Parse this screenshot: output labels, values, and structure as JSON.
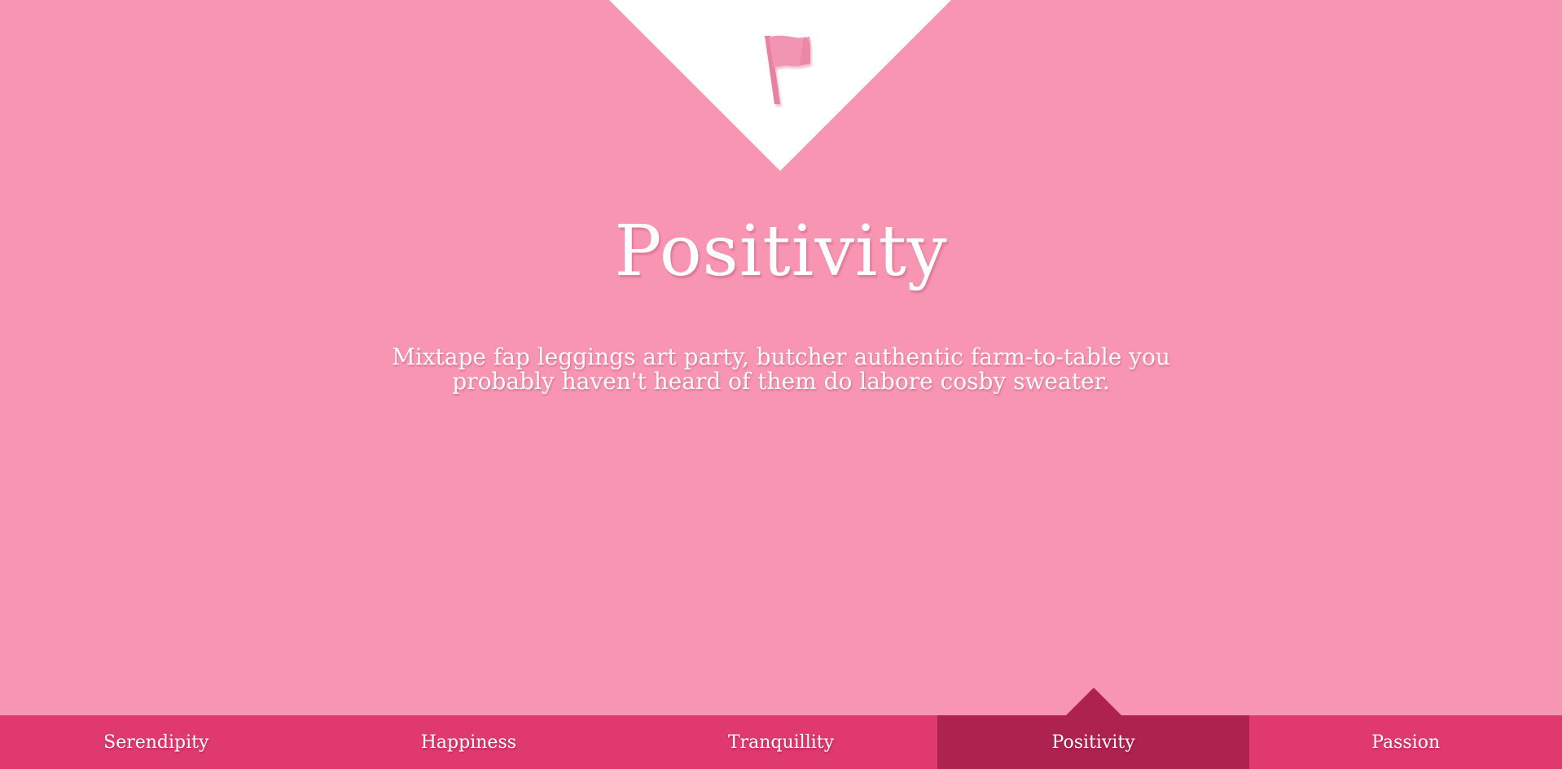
{
  "theme": {
    "background": "#f795b2",
    "nav_background": "#e0396f",
    "nav_active_background": "#ad224f",
    "text": "#ffffff"
  },
  "hero": {
    "icon": "flag-icon",
    "title": "Positivity",
    "description": "Mixtape fap leggings art party, butcher authentic farm-to-table you probably haven't heard of them do labore cosby sweater."
  },
  "nav": {
    "active_index": 3,
    "items": [
      {
        "label": "Serendipity"
      },
      {
        "label": "Happiness"
      },
      {
        "label": "Tranquillity"
      },
      {
        "label": "Positivity"
      },
      {
        "label": "Passion"
      }
    ]
  }
}
